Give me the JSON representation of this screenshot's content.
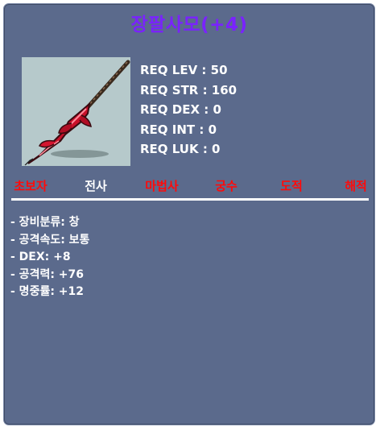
{
  "tooltip": {
    "title": "장팔사모(+4)",
    "item_icon": "red-spear-icon",
    "requirements": [
      "REQ LEV : 50",
      "REQ STR : 160",
      "REQ DEX : 0",
      "REQ INT : 0",
      "REQ LUK : 0"
    ],
    "jobs": [
      {
        "label": "초보자",
        "color": "#ff0a0a"
      },
      {
        "label": "전사",
        "color": "#ffffff"
      },
      {
        "label": "마법사",
        "color": "#ff0a0a"
      },
      {
        "label": "궁수",
        "color": "#ff0a0a"
      },
      {
        "label": "도적",
        "color": "#ff0a0a"
      },
      {
        "label": "해적",
        "color": "#ff0a0a"
      }
    ],
    "stats": [
      "- 장비분류: 창",
      "- 공격속도: 보통",
      "- DEX: +8",
      "- 공격력: +76",
      "- 명중률: +12"
    ],
    "colors": {
      "background": "#5b6a8c",
      "title": "#7a22ff",
      "unavailable_job": "#ff0a0a",
      "available_job": "#ffffff"
    }
  }
}
